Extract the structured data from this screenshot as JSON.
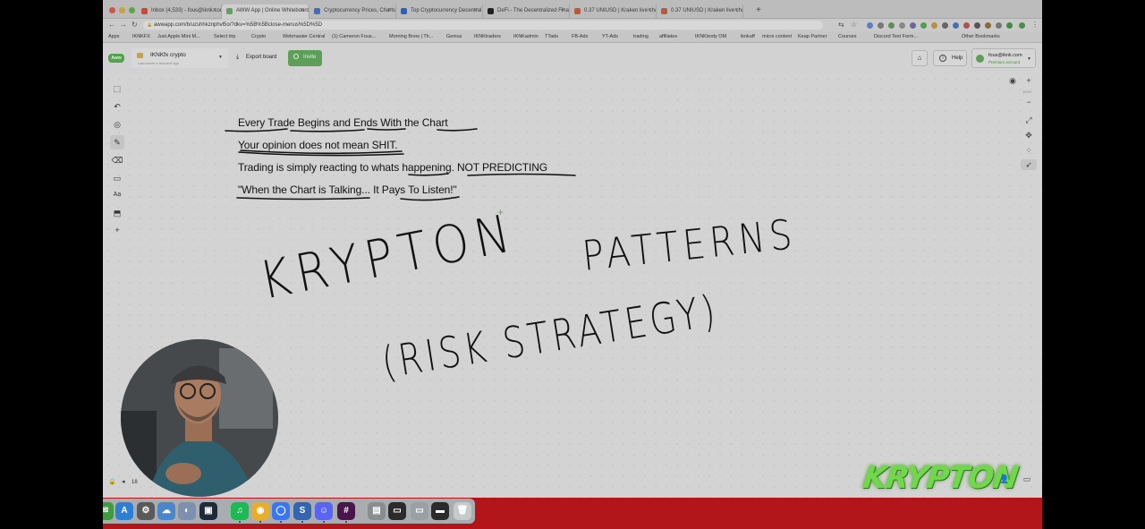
{
  "browser": {
    "tabs": [
      {
        "label": "Inbox (4,533) - fous@iknk.com",
        "favicon_color": "#c44a3c",
        "active": false
      },
      {
        "label": "AWW App | Online Whiteboard",
        "favicon_color": "#5ea55a",
        "active": true
      },
      {
        "label": "Cryptocurrency Prices, Charts",
        "favicon_color": "#3b6fc6",
        "active": false
      },
      {
        "label": "Top Cryptocurrency Decentral",
        "favicon_color": "#2f5fb8",
        "active": false
      },
      {
        "label": "DeFi - The Decentralized Fina",
        "favicon_color": "#222222",
        "active": false
      },
      {
        "label": "0.37 UNIUSD | Kraken live cha",
        "favicon_color": "#b85a3a",
        "active": false
      },
      {
        "label": "0.37 UNIUSD | Kraken live cha",
        "favicon_color": "#b85a3a",
        "active": false
      }
    ],
    "new_tab_icon": "+",
    "url": "awwapp.com/b/uzshhkznphvl5o/?dkv=%5B%5Bclose-menus%5D%5D",
    "bookmarks": [
      "Apps",
      "IKNKFX",
      "Just Apple Mini M...",
      "Select trip",
      "Crypto",
      "Webmaster Central",
      "(1) Cameron Fous...",
      "Morning Brew | Th...",
      "Genius",
      "IKNKtraders",
      "IKNKadmin",
      "TTads",
      "FB-Ads",
      "YT-Ads",
      "trading",
      "affiliates",
      "IKNKbody OM",
      "iknkaff",
      "micro content",
      "Keap Partner",
      "Courses",
      "Discord Text Form...",
      "Other Bookmarks"
    ]
  },
  "app": {
    "logo_text": "Aww",
    "board_name": "IKNKfx crypto",
    "board_subtitle": "Last saved a moment ago",
    "export_label": "Export board",
    "invite_label": "Invite",
    "help_label": "Help",
    "account_email": "fous@iknk.com",
    "account_plan": "Premium account"
  },
  "left_tools": [
    {
      "name": "select-tool",
      "glyph": "⬚",
      "selected": false
    },
    {
      "name": "undo-tool",
      "glyph": "↶",
      "selected": false
    },
    {
      "name": "color-tool",
      "glyph": "◎",
      "selected": false
    },
    {
      "name": "pen-tool",
      "glyph": "✎",
      "selected": true
    },
    {
      "name": "eraser-tool",
      "glyph": "⌫",
      "selected": false
    },
    {
      "name": "shape-tool",
      "glyph": "▭",
      "selected": false
    },
    {
      "name": "text-tool",
      "glyph": "Aa",
      "selected": false
    },
    {
      "name": "sticky-note-tool",
      "glyph": "⬒",
      "selected": false
    },
    {
      "name": "more-tools",
      "glyph": "+",
      "selected": false
    }
  ],
  "right_tools": {
    "eye": "◉",
    "zoom_in": "+",
    "zoom_level": "100%",
    "zoom_out": "−",
    "fit": "⤢",
    "move": "✥",
    "grid": "⁘",
    "laser": "➶"
  },
  "notes": [
    "Every Trade Begins and Ends With the Chart",
    "Your opinion does not mean SHIT.",
    "Trading is simply reacting to whats happening. NOT PREDICTING",
    "\"When the Chart is Talking... It Pays To Listen!\""
  ],
  "handwriting": {
    "line1a": "KRYPTON",
    "line1b": "PATTERNS",
    "line2": "(RISK STRATEGY)"
  },
  "overlay_logo_text": "KRYPTON",
  "page_number": "18",
  "bottom_icons": {
    "lock": "🔒",
    "prev": "◂",
    "user": "👤",
    "chat": "▭"
  },
  "dock_apps": [
    {
      "name": "spotify-icon",
      "color": "#1db954",
      "glyph": "♫"
    },
    {
      "name": "chrome-icon",
      "color": "#e8ad2a",
      "glyph": "◉"
    },
    {
      "name": "signal-icon",
      "color": "#3a76f0",
      "glyph": "◯"
    },
    {
      "name": "s-app-icon",
      "color": "#3466b0",
      "glyph": "S"
    },
    {
      "name": "discord-icon",
      "color": "#5865f2",
      "glyph": "☺"
    },
    {
      "name": "slack-icon",
      "color": "#4a154b",
      "glyph": "#"
    },
    {
      "name": "preview-icon",
      "color": "#8a8d90",
      "glyph": "▤"
    },
    {
      "name": "screen-icon",
      "color": "#2b2b2b",
      "glyph": "▭"
    },
    {
      "name": "window-icon",
      "color": "#9aa0a4",
      "glyph": "▭"
    },
    {
      "name": "desktop-icon",
      "color": "#2b2b2b",
      "glyph": "▬"
    },
    {
      "name": "trash-icon",
      "color": "#c7cacc",
      "glyph": "🗑"
    }
  ]
}
